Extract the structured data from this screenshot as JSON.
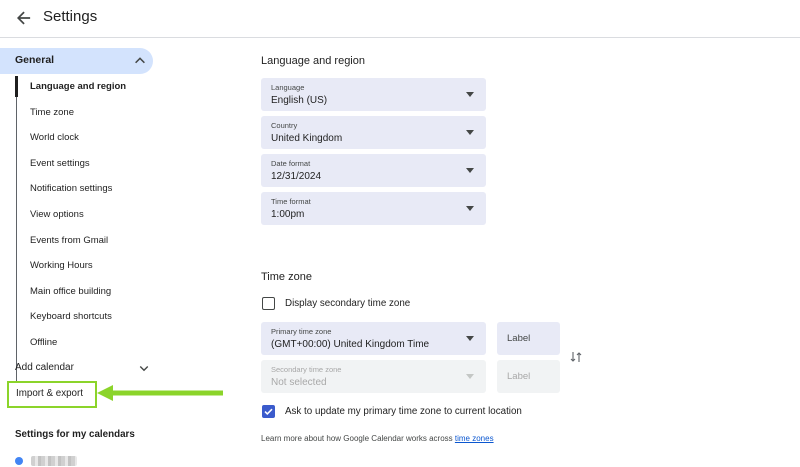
{
  "header": {
    "title": "Settings"
  },
  "sidebar": {
    "general_label": "General",
    "items": [
      "Language and region",
      "Time zone",
      "World clock",
      "Event settings",
      "Notification settings",
      "View options",
      "Events from Gmail",
      "Working Hours",
      "Main office building",
      "Keyboard shortcuts",
      "Offline"
    ],
    "add_calendar": "Add calendar",
    "import_export": "Import & export",
    "my_calendars_header": "Settings for my calendars"
  },
  "language_region": {
    "title": "Language and region",
    "fields": [
      {
        "label": "Language",
        "value": "English (US)"
      },
      {
        "label": "Country",
        "value": "United Kingdom"
      },
      {
        "label": "Date format",
        "value": "12/31/2024"
      },
      {
        "label": "Time format",
        "value": "1:00pm"
      }
    ]
  },
  "time_zone": {
    "title": "Time zone",
    "secondary_checkbox": "Display secondary time zone",
    "primary": {
      "label": "Primary time zone",
      "value": "(GMT+00:00) United Kingdom Time"
    },
    "secondary": {
      "label": "Secondary time zone",
      "value": "Not selected"
    },
    "label_placeholder": "Label",
    "ask_update": "Ask to update my primary time zone to current location",
    "learn_more_text": "Learn more about how Google Calendar works across ",
    "learn_more_link": "time zones"
  },
  "colors": {
    "accent": "#0b57d0",
    "nav_highlight": "#d3e3fd",
    "field_bg": "#e8eaf6",
    "annotation": "#8bd42a",
    "checkbox": "#3b5bcc"
  },
  "icons": {
    "back": "arrow-left-icon",
    "expand": "chevron-up-icon",
    "collapse": "chevron-down-icon",
    "dropdown": "caret-down-icon",
    "swap": "swap-vertical-icon"
  }
}
